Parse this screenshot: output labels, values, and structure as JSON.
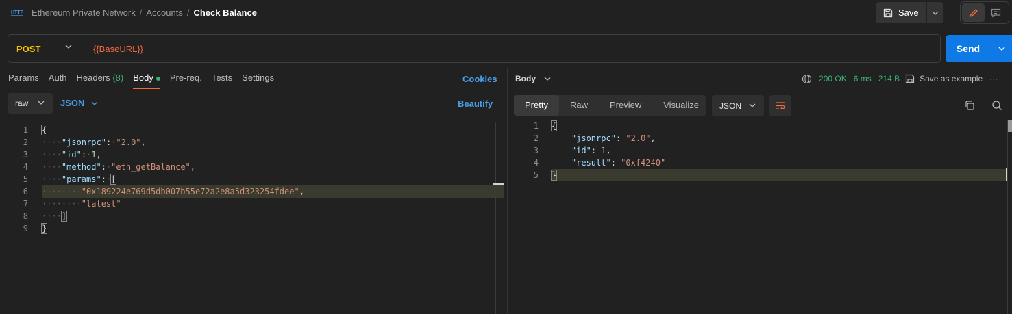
{
  "breadcrumb": {
    "collection": "Ethereum Private Network",
    "folder": "Accounts",
    "request": "Check Balance",
    "separator": "/"
  },
  "toolbar": {
    "save_label": "Save"
  },
  "request": {
    "method": "POST",
    "url": "{{BaseURL}}",
    "send_label": "Send"
  },
  "request_tabs": {
    "params": "Params",
    "auth": "Auth",
    "headers": "Headers",
    "headers_count": "(8)",
    "body": "Body",
    "prereq": "Pre-req.",
    "tests": "Tests",
    "settings": "Settings",
    "cookies": "Cookies"
  },
  "body_options": {
    "mode": "raw",
    "language": "JSON",
    "beautify": "Beautify"
  },
  "request_body_lines": [
    {
      "n": "1"
    },
    {
      "n": "2"
    },
    {
      "n": "3"
    },
    {
      "n": "4"
    },
    {
      "n": "5"
    },
    {
      "n": "6"
    },
    {
      "n": "7"
    },
    {
      "n": "8"
    },
    {
      "n": "9"
    }
  ],
  "request_body": {
    "jsonrpc_key": "\"jsonrpc\"",
    "jsonrpc_val": "\"2.0\"",
    "id_key": "\"id\"",
    "id_val": "1",
    "method_key": "\"method\"",
    "method_val": "\"eth_getBalance\"",
    "params_key": "\"params\"",
    "param_address": "\"0x189224e769d5db007b55e72a2e8a5d323254fdee\"",
    "param_block": "\"latest\""
  },
  "response": {
    "body_label": "Body",
    "status": "200 OK",
    "time": "6 ms",
    "size": "214 B",
    "save_example": "Save as example",
    "more": "∙∙∙",
    "views": [
      "Pretty",
      "Raw",
      "Preview",
      "Visualize"
    ],
    "language": "JSON"
  },
  "response_body": {
    "jsonrpc_key": "\"jsonrpc\"",
    "jsonrpc_val": "\"2.0\"",
    "id_key": "\"id\"",
    "id_val": "1",
    "result_key": "\"result\"",
    "result_val": "\"0xf4240\""
  },
  "colors": {
    "accent_blue": "#0f7ae5",
    "method_yellow": "#f3c300",
    "url_orange": "#f06843",
    "status_green": "#3cb371",
    "tab_underline": "#f26b3a"
  }
}
